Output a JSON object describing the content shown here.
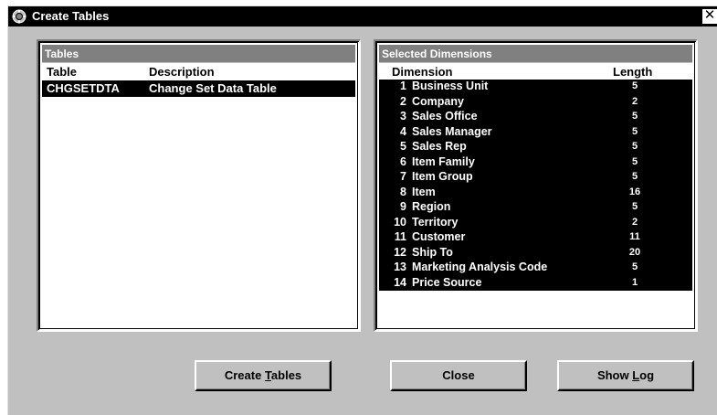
{
  "window": {
    "title": "Create Tables",
    "close_glyph": "✕"
  },
  "tables_panel": {
    "header": "Tables",
    "columns": {
      "table": "Table",
      "description": "Description"
    },
    "rows": [
      {
        "table": "CHGSETDTA",
        "description": "Change Set Data Table"
      }
    ]
  },
  "dimensions_panel": {
    "header": "Selected Dimensions",
    "columns": {
      "dimension": "Dimension",
      "length": "Length"
    },
    "rows": [
      {
        "num": "1",
        "name": "Business Unit",
        "length": "5"
      },
      {
        "num": "2",
        "name": "Company",
        "length": "2"
      },
      {
        "num": "3",
        "name": "Sales Office",
        "length": "5"
      },
      {
        "num": "4",
        "name": "Sales Manager",
        "length": "5"
      },
      {
        "num": "5",
        "name": "Sales Rep",
        "length": "5"
      },
      {
        "num": "6",
        "name": "Item Family",
        "length": "5"
      },
      {
        "num": "7",
        "name": "Item Group",
        "length": "5"
      },
      {
        "num": "8",
        "name": "Item",
        "length": "16"
      },
      {
        "num": "9",
        "name": "Region",
        "length": "5"
      },
      {
        "num": "10",
        "name": "Territory",
        "length": "2"
      },
      {
        "num": "11",
        "name": "Customer",
        "length": "11"
      },
      {
        "num": "12",
        "name": "Ship To",
        "length": "20"
      },
      {
        "num": "13",
        "name": "Marketing Analysis Code",
        "length": "5"
      },
      {
        "num": "14",
        "name": "Price Source",
        "length": "1"
      }
    ]
  },
  "buttons": {
    "create_tables": {
      "before": "Create ",
      "mnemonic": "T",
      "after": "ables"
    },
    "close": {
      "label": "Close"
    },
    "show_log": {
      "before": "Show ",
      "mnemonic": "L",
      "after": "og"
    }
  },
  "icons": {
    "app": "app-gear-icon",
    "close": "close-icon"
  }
}
